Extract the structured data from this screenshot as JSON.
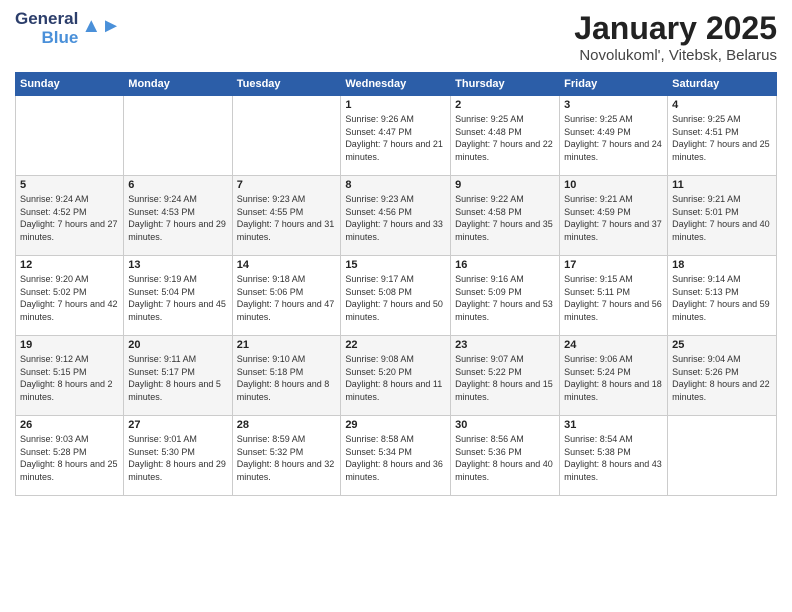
{
  "logo": {
    "line1": "General",
    "line2": "Blue"
  },
  "title": "January 2025",
  "location": "Novolukoml', Vitebsk, Belarus",
  "headers": [
    "Sunday",
    "Monday",
    "Tuesday",
    "Wednesday",
    "Thursday",
    "Friday",
    "Saturday"
  ],
  "weeks": [
    [
      {
        "day": "",
        "info": ""
      },
      {
        "day": "",
        "info": ""
      },
      {
        "day": "",
        "info": ""
      },
      {
        "day": "1",
        "info": "Sunrise: 9:26 AM\nSunset: 4:47 PM\nDaylight: 7 hours and 21 minutes."
      },
      {
        "day": "2",
        "info": "Sunrise: 9:25 AM\nSunset: 4:48 PM\nDaylight: 7 hours and 22 minutes."
      },
      {
        "day": "3",
        "info": "Sunrise: 9:25 AM\nSunset: 4:49 PM\nDaylight: 7 hours and 24 minutes."
      },
      {
        "day": "4",
        "info": "Sunrise: 9:25 AM\nSunset: 4:51 PM\nDaylight: 7 hours and 25 minutes."
      }
    ],
    [
      {
        "day": "5",
        "info": "Sunrise: 9:24 AM\nSunset: 4:52 PM\nDaylight: 7 hours and 27 minutes."
      },
      {
        "day": "6",
        "info": "Sunrise: 9:24 AM\nSunset: 4:53 PM\nDaylight: 7 hours and 29 minutes."
      },
      {
        "day": "7",
        "info": "Sunrise: 9:23 AM\nSunset: 4:55 PM\nDaylight: 7 hours and 31 minutes."
      },
      {
        "day": "8",
        "info": "Sunrise: 9:23 AM\nSunset: 4:56 PM\nDaylight: 7 hours and 33 minutes."
      },
      {
        "day": "9",
        "info": "Sunrise: 9:22 AM\nSunset: 4:58 PM\nDaylight: 7 hours and 35 minutes."
      },
      {
        "day": "10",
        "info": "Sunrise: 9:21 AM\nSunset: 4:59 PM\nDaylight: 7 hours and 37 minutes."
      },
      {
        "day": "11",
        "info": "Sunrise: 9:21 AM\nSunset: 5:01 PM\nDaylight: 7 hours and 40 minutes."
      }
    ],
    [
      {
        "day": "12",
        "info": "Sunrise: 9:20 AM\nSunset: 5:02 PM\nDaylight: 7 hours and 42 minutes."
      },
      {
        "day": "13",
        "info": "Sunrise: 9:19 AM\nSunset: 5:04 PM\nDaylight: 7 hours and 45 minutes."
      },
      {
        "day": "14",
        "info": "Sunrise: 9:18 AM\nSunset: 5:06 PM\nDaylight: 7 hours and 47 minutes."
      },
      {
        "day": "15",
        "info": "Sunrise: 9:17 AM\nSunset: 5:08 PM\nDaylight: 7 hours and 50 minutes."
      },
      {
        "day": "16",
        "info": "Sunrise: 9:16 AM\nSunset: 5:09 PM\nDaylight: 7 hours and 53 minutes."
      },
      {
        "day": "17",
        "info": "Sunrise: 9:15 AM\nSunset: 5:11 PM\nDaylight: 7 hours and 56 minutes."
      },
      {
        "day": "18",
        "info": "Sunrise: 9:14 AM\nSunset: 5:13 PM\nDaylight: 7 hours and 59 minutes."
      }
    ],
    [
      {
        "day": "19",
        "info": "Sunrise: 9:12 AM\nSunset: 5:15 PM\nDaylight: 8 hours and 2 minutes."
      },
      {
        "day": "20",
        "info": "Sunrise: 9:11 AM\nSunset: 5:17 PM\nDaylight: 8 hours and 5 minutes."
      },
      {
        "day": "21",
        "info": "Sunrise: 9:10 AM\nSunset: 5:18 PM\nDaylight: 8 hours and 8 minutes."
      },
      {
        "day": "22",
        "info": "Sunrise: 9:08 AM\nSunset: 5:20 PM\nDaylight: 8 hours and 11 minutes."
      },
      {
        "day": "23",
        "info": "Sunrise: 9:07 AM\nSunset: 5:22 PM\nDaylight: 8 hours and 15 minutes."
      },
      {
        "day": "24",
        "info": "Sunrise: 9:06 AM\nSunset: 5:24 PM\nDaylight: 8 hours and 18 minutes."
      },
      {
        "day": "25",
        "info": "Sunrise: 9:04 AM\nSunset: 5:26 PM\nDaylight: 8 hours and 22 minutes."
      }
    ],
    [
      {
        "day": "26",
        "info": "Sunrise: 9:03 AM\nSunset: 5:28 PM\nDaylight: 8 hours and 25 minutes."
      },
      {
        "day": "27",
        "info": "Sunrise: 9:01 AM\nSunset: 5:30 PM\nDaylight: 8 hours and 29 minutes."
      },
      {
        "day": "28",
        "info": "Sunrise: 8:59 AM\nSunset: 5:32 PM\nDaylight: 8 hours and 32 minutes."
      },
      {
        "day": "29",
        "info": "Sunrise: 8:58 AM\nSunset: 5:34 PM\nDaylight: 8 hours and 36 minutes."
      },
      {
        "day": "30",
        "info": "Sunrise: 8:56 AM\nSunset: 5:36 PM\nDaylight: 8 hours and 40 minutes."
      },
      {
        "day": "31",
        "info": "Sunrise: 8:54 AM\nSunset: 5:38 PM\nDaylight: 8 hours and 43 minutes."
      },
      {
        "day": "",
        "info": ""
      }
    ]
  ]
}
